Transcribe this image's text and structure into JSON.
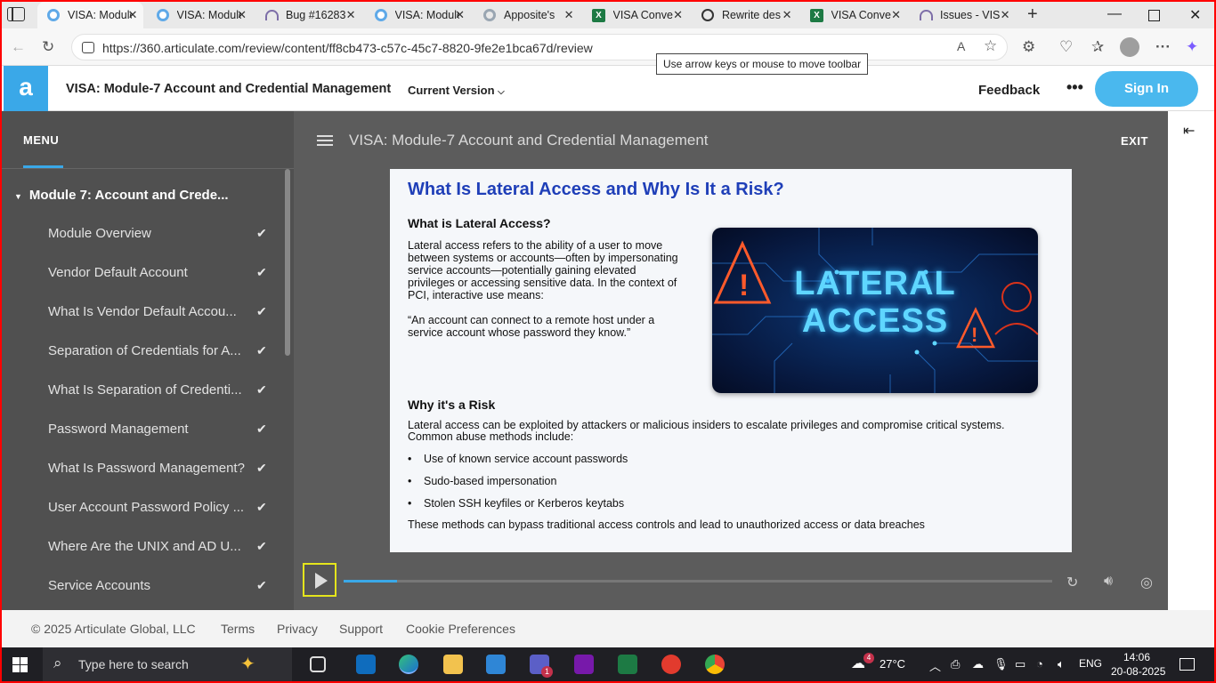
{
  "browser": {
    "tabs": [
      {
        "title": "VISA: Module",
        "icon": "articulate-favicon",
        "active": true
      },
      {
        "title": "VISA: Module",
        "icon": "articulate-favicon",
        "active": false
      },
      {
        "title": "Bug #16283",
        "icon": "bug-tracker-favicon",
        "active": false
      },
      {
        "title": "VISA: Module",
        "icon": "articulate-favicon",
        "active": false
      },
      {
        "title": "Apposite's",
        "icon": "grey-circle-favicon",
        "active": false
      },
      {
        "title": "VISA Conve",
        "icon": "excel-favicon",
        "active": false
      },
      {
        "title": "Rewrite des",
        "icon": "chatgpt-favicon",
        "active": false
      },
      {
        "title": "VISA Conve",
        "icon": "excel-favicon",
        "active": false
      },
      {
        "title": "Issues - VIS",
        "icon": "bug-tracker-favicon",
        "active": false
      }
    ],
    "url": "https://360.articulate.com/review/content/ff8cb473-c57c-45c7-8820-9fe2e1bca67d/review",
    "tooltip": "Use arrow keys or mouse to move toolbar"
  },
  "header": {
    "logo": "a",
    "title": "VISA: Module-7 Account and Credential Management",
    "version": "Current Version",
    "feedback": "Feedback",
    "more": "•••",
    "signin": "Sign In"
  },
  "menu": {
    "heading": "MENU",
    "module": "Module 7: Account and Crede...",
    "items": [
      {
        "label": "Module Overview"
      },
      {
        "label": "Vendor Default Account"
      },
      {
        "label": "What Is Vendor Default Accou..."
      },
      {
        "label": "Separation of Credentials for A..."
      },
      {
        "label": "What Is Separation of Credenti..."
      },
      {
        "label": "Password Management"
      },
      {
        "label": "What Is Password Management?"
      },
      {
        "label": "User Account Password Policy ..."
      },
      {
        "label": "Where Are the UNIX and AD U..."
      },
      {
        "label": "Service Accounts"
      }
    ]
  },
  "player": {
    "title": "VISA: Module-7 Account and Credential Management",
    "exit": "EXIT",
    "progress": 0.075
  },
  "slide": {
    "title": "What Is Lateral Access and Why Is It a Risk?",
    "h1": "What is Lateral Access?",
    "p1": "Lateral access refers to the ability of a user to move between systems or accounts—often by impersonating service accounts—potentially gaining elevated privileges or accessing sensitive data. In the context of PCI, interactive use means:",
    "quote": "“An account can connect to a remote host under a service account whose password they know.”",
    "image_line1": "LATERAL",
    "image_line2": "ACCESS",
    "h2": "Why it's a Risk",
    "p2": "Lateral access can be exploited by attackers or malicious insiders to escalate privileges and compromise critical systems. Common abuse methods include:",
    "bullets": [
      "Use of known service account passwords",
      "Sudo-based impersonation",
      "Stolen SSH keyfiles or Kerberos keytabs"
    ],
    "closing": "These methods can bypass traditional access controls and lead to unauthorized access or data breaches"
  },
  "footer": {
    "copyright": "© 2025 Articulate Global, LLC",
    "terms": "Terms",
    "privacy": "Privacy",
    "support": "Support",
    "cookies": "Cookie Preferences"
  },
  "taskbar": {
    "search_placeholder": "Type here to search",
    "weather": "27°C",
    "language": "ENG",
    "time": "14:06",
    "date": "20-08-2025",
    "teams_badge": "1",
    "weather_badge": "4"
  }
}
